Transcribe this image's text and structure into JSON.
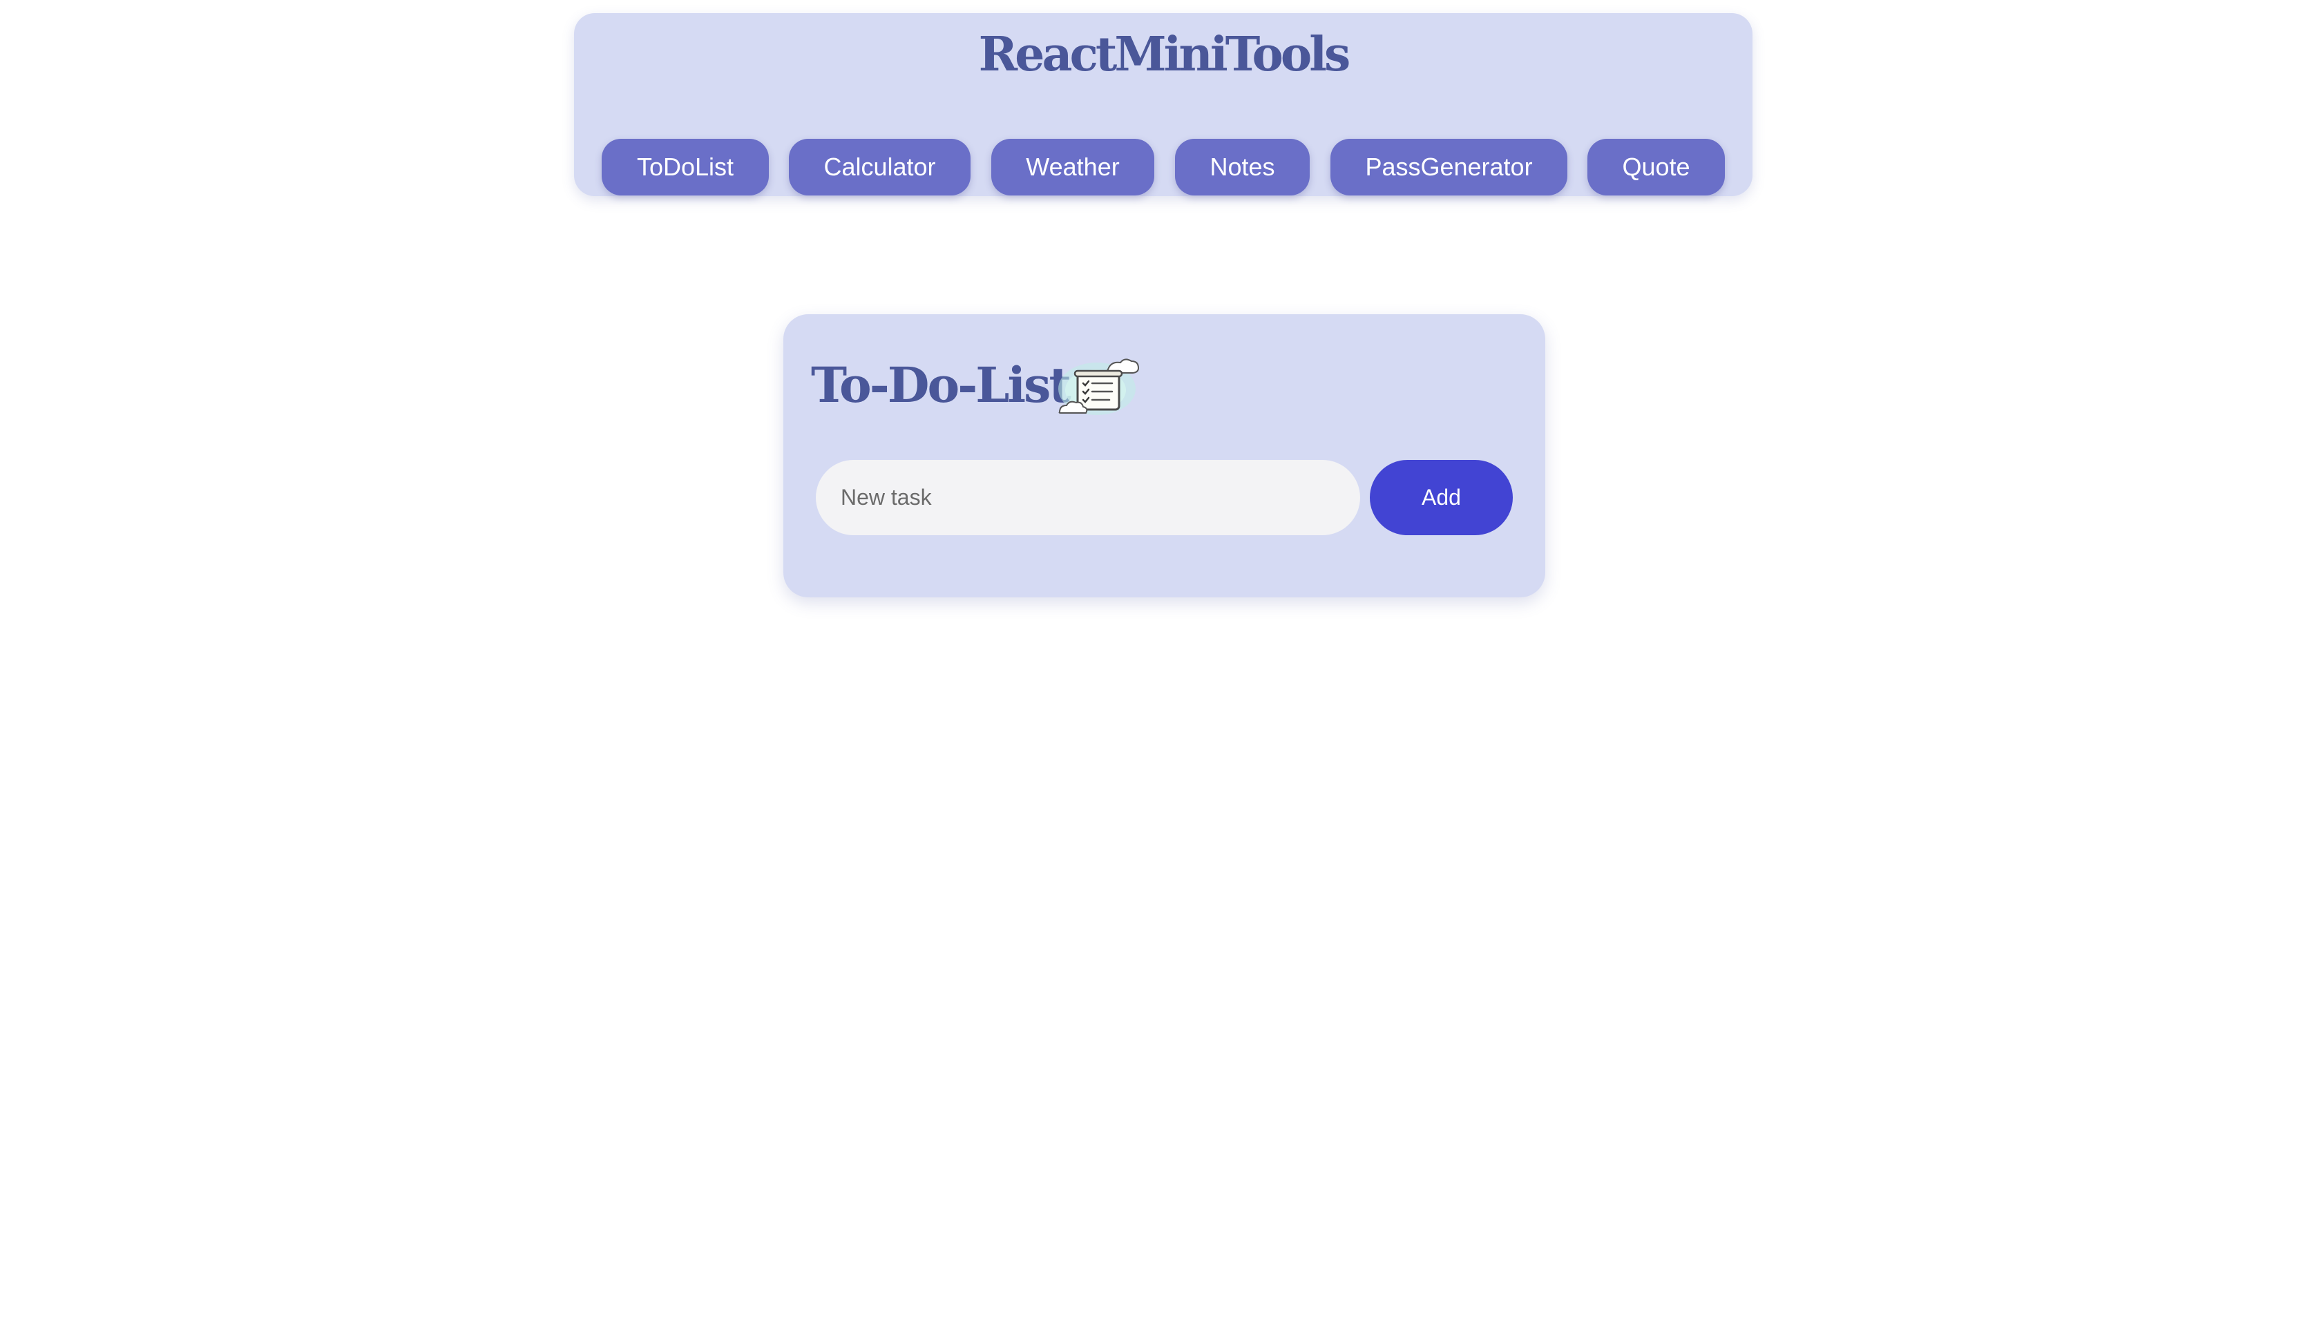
{
  "header": {
    "title": "ReactMiniTools",
    "nav": [
      {
        "label": "ToDoList"
      },
      {
        "label": "Calculator"
      },
      {
        "label": "Weather"
      },
      {
        "label": "Notes"
      },
      {
        "label": "PassGenerator"
      },
      {
        "label": "Quote"
      }
    ]
  },
  "todo": {
    "title": "To-Do-List",
    "icon": "checklist-clipboard-icon",
    "input": {
      "placeholder": "New task",
      "value": ""
    },
    "add_label": "Add",
    "tasks": []
  },
  "colors": {
    "panel_bg": "#d5daf3",
    "title_text": "#4a5799",
    "nav_button": "#6a6fc8",
    "add_button": "#4244d3",
    "input_bg": "#f3f3f5"
  }
}
